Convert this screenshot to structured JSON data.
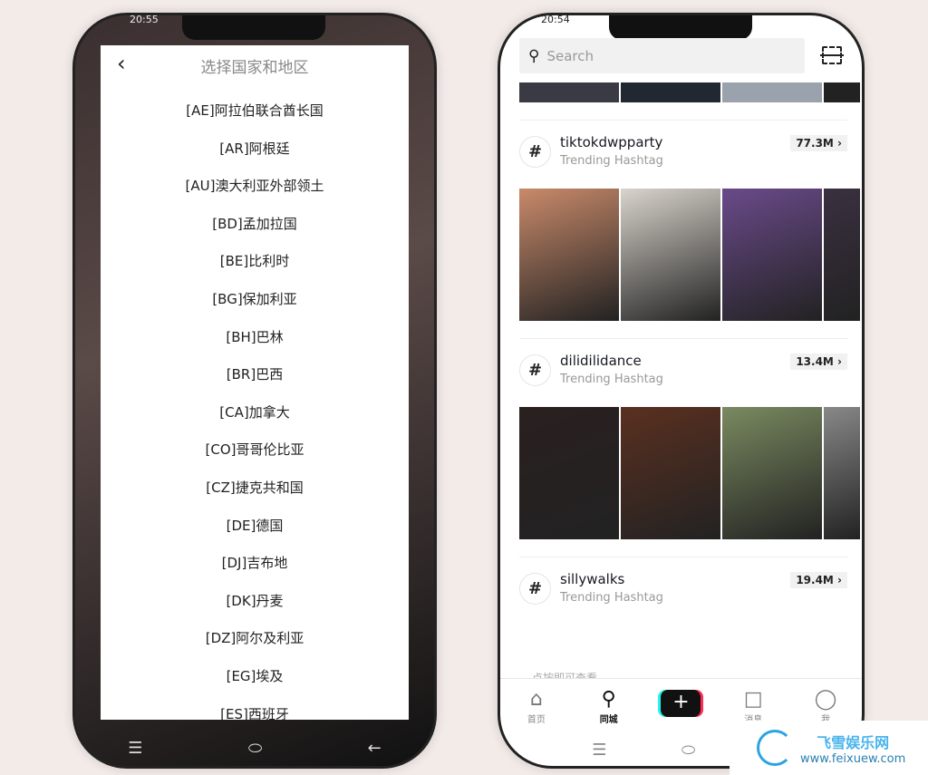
{
  "left_phone": {
    "status_time": "20:55",
    "modal": {
      "title": "选择国家和地区",
      "countries": [
        "[AE]阿拉伯联合酋长国",
        "[AR]阿根廷",
        "[AU]澳大利亚外部领土",
        "[BD]孟加拉国",
        "[BE]比利时",
        "[BG]保加利亚",
        "[BH]巴林",
        "[BR]巴西",
        "[CA]加拿大",
        "[CO]哥哥伦比亚",
        "[CZ]捷克共和国",
        "[DE]德国",
        "[DJ]吉布地",
        "[DK]丹麦",
        "[DZ]阿尔及利亚",
        "[EG]埃及",
        "[ES]西班牙"
      ]
    }
  },
  "right_phone": {
    "status_time": "20:54",
    "search": {
      "placeholder": "Search"
    },
    "hashtags": [
      {
        "name": "tiktokdwpparty",
        "subtitle": "Trending Hashtag",
        "count": "77.3M"
      },
      {
        "name": "dilidilidance",
        "subtitle": "Trending Hashtag",
        "count": "13.4M"
      },
      {
        "name": "sillywalks",
        "subtitle": "Trending Hashtag",
        "count": "19.4M"
      }
    ],
    "hint": "点按即可查看",
    "tabs": [
      {
        "label": "首页",
        "icon": "home-icon"
      },
      {
        "label": "同城",
        "icon": "search-icon"
      },
      {
        "label": "",
        "icon": "plus-icon"
      },
      {
        "label": "消息",
        "icon": "message-icon"
      },
      {
        "label": "我",
        "icon": "profile-icon"
      }
    ]
  },
  "watermark": {
    "title": "飞雪娱乐网",
    "url": "www.feixuew.com"
  }
}
